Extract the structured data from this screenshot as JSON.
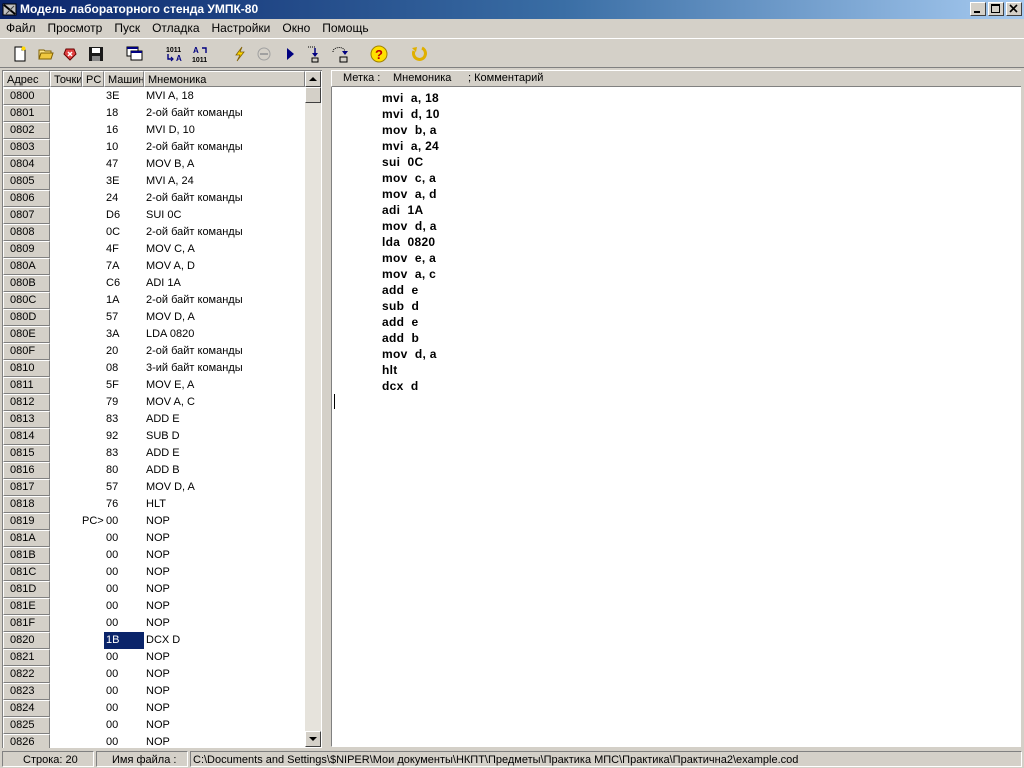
{
  "window": {
    "title": "Модель лабораторного стенда УМПК-80"
  },
  "menu": [
    "Файл",
    "Просмотр",
    "Пуск",
    "Отладка",
    "Настройки",
    "Окно",
    "Помощь"
  ],
  "toolbar": {
    "icons": [
      "new-file-icon",
      "open-folder-icon",
      "erase-icon",
      "save-icon",
      "windows-icon",
      "binary-to-asm-icon",
      "asm-to-binary-icon",
      "run-lightning-icon",
      "stop-icon",
      "step-icon",
      "step-into-icon",
      "step-over-icon",
      "help-icon",
      "restart-icon"
    ],
    "asm_to_bin_top": "1011",
    "asm_to_bin_bottom": "A",
    "bin_to_asm_top": "A",
    "bin_to_asm_bottom": "1011"
  },
  "left_table": {
    "headers": [
      "Адрес",
      "Точки",
      "PC",
      "Машин",
      "Мнемоника"
    ],
    "rows": [
      {
        "addr": "0800",
        "pts": "",
        "pc": "",
        "mc": "3E",
        "mn": "MVI  A, 18"
      },
      {
        "addr": "0801",
        "pts": "",
        "pc": "",
        "mc": "18",
        "mn": "2-ой байт команды"
      },
      {
        "addr": "0802",
        "pts": "",
        "pc": "",
        "mc": "16",
        "mn": "MVI  D, 10"
      },
      {
        "addr": "0803",
        "pts": "",
        "pc": "",
        "mc": "10",
        "mn": "2-ой байт команды"
      },
      {
        "addr": "0804",
        "pts": "",
        "pc": "",
        "mc": "47",
        "mn": "MOV  B, A"
      },
      {
        "addr": "0805",
        "pts": "",
        "pc": "",
        "mc": "3E",
        "mn": "MVI  A, 24"
      },
      {
        "addr": "0806",
        "pts": "",
        "pc": "",
        "mc": "24",
        "mn": "2-ой байт команды"
      },
      {
        "addr": "0807",
        "pts": "",
        "pc": "",
        "mc": "D6",
        "mn": "SUI  0C"
      },
      {
        "addr": "0808",
        "pts": "",
        "pc": "",
        "mc": "0C",
        "mn": "2-ой байт команды"
      },
      {
        "addr": "0809",
        "pts": "",
        "pc": "",
        "mc": "4F",
        "mn": "MOV  C, A"
      },
      {
        "addr": "080A",
        "pts": "",
        "pc": "",
        "mc": "7A",
        "mn": "MOV  A, D"
      },
      {
        "addr": "080B",
        "pts": "",
        "pc": "",
        "mc": "C6",
        "mn": "ADI  1A"
      },
      {
        "addr": "080C",
        "pts": "",
        "pc": "",
        "mc": "1A",
        "mn": "2-ой байт команды"
      },
      {
        "addr": "080D",
        "pts": "",
        "pc": "",
        "mc": "57",
        "mn": "MOV  D, A"
      },
      {
        "addr": "080E",
        "pts": "",
        "pc": "",
        "mc": "3A",
        "mn": "LDA  0820"
      },
      {
        "addr": "080F",
        "pts": "",
        "pc": "",
        "mc": "20",
        "mn": "2-ой байт команды"
      },
      {
        "addr": "0810",
        "pts": "",
        "pc": "",
        "mc": "08",
        "mn": "3-ий байт команды"
      },
      {
        "addr": "0811",
        "pts": "",
        "pc": "",
        "mc": "5F",
        "mn": "MOV  E, A"
      },
      {
        "addr": "0812",
        "pts": "",
        "pc": "",
        "mc": "79",
        "mn": "MOV  A, C"
      },
      {
        "addr": "0813",
        "pts": "",
        "pc": "",
        "mc": "83",
        "mn": "ADD  E"
      },
      {
        "addr": "0814",
        "pts": "",
        "pc": "",
        "mc": "92",
        "mn": "SUB  D"
      },
      {
        "addr": "0815",
        "pts": "",
        "pc": "",
        "mc": "83",
        "mn": "ADD  E"
      },
      {
        "addr": "0816",
        "pts": "",
        "pc": "",
        "mc": "80",
        "mn": "ADD  B"
      },
      {
        "addr": "0817",
        "pts": "",
        "pc": "",
        "mc": "57",
        "mn": "MOV  D, A"
      },
      {
        "addr": "0818",
        "pts": "",
        "pc": "",
        "mc": "76",
        "mn": "HLT"
      },
      {
        "addr": "0819",
        "pts": "",
        "pc": "PC>",
        "mc": "00",
        "mn": "NOP"
      },
      {
        "addr": "081A",
        "pts": "",
        "pc": "",
        "mc": "00",
        "mn": "NOP"
      },
      {
        "addr": "081B",
        "pts": "",
        "pc": "",
        "mc": "00",
        "mn": "NOP"
      },
      {
        "addr": "081C",
        "pts": "",
        "pc": "",
        "mc": "00",
        "mn": "NOP"
      },
      {
        "addr": "081D",
        "pts": "",
        "pc": "",
        "mc": "00",
        "mn": "NOP"
      },
      {
        "addr": "081E",
        "pts": "",
        "pc": "",
        "mc": "00",
        "mn": "NOP"
      },
      {
        "addr": "081F",
        "pts": "",
        "pc": "",
        "mc": "00",
        "mn": "NOP"
      },
      {
        "addr": "0820",
        "pts": "",
        "pc": "",
        "mc": "1B",
        "mn": "DCX  D",
        "selected": true
      },
      {
        "addr": "0821",
        "pts": "",
        "pc": "",
        "mc": "00",
        "mn": "NOP"
      },
      {
        "addr": "0822",
        "pts": "",
        "pc": "",
        "mc": "00",
        "mn": "NOP"
      },
      {
        "addr": "0823",
        "pts": "",
        "pc": "",
        "mc": "00",
        "mn": "NOP"
      },
      {
        "addr": "0824",
        "pts": "",
        "pc": "",
        "mc": "00",
        "mn": "NOP"
      },
      {
        "addr": "0825",
        "pts": "",
        "pc": "",
        "mc": "00",
        "mn": "NOP"
      },
      {
        "addr": "0826",
        "pts": "",
        "pc": "",
        "mc": "00",
        "mn": "NOP"
      }
    ]
  },
  "editor": {
    "header": {
      "label": "Метка :",
      "mnemonic": "Мнемоника",
      "comment": "; Комментарий"
    },
    "lines": [
      "mvi  a, 18",
      "mvi  d, 10",
      "mov  b, a",
      "mvi  a, 24",
      "sui  0C",
      "mov  c, a",
      "mov  a, d",
      "adi  1A",
      "mov  d, a",
      "lda  0820",
      "mov  e, a",
      "mov  a, c",
      "add  e",
      "sub  d",
      "add  e",
      "add  b",
      "mov  d, a",
      "hlt",
      "dcx  d"
    ]
  },
  "status": {
    "line": "Строка: 20",
    "file_label": "Имя файла :",
    "file_path": "C:\\Documents and Settings\\$NIPER\\Мои документы\\НКПТ\\Предметы\\Практика МПС\\Практика\\Практична2\\example.cod"
  },
  "colors": {
    "selection": "#0a246a",
    "title_gradient_start": "#0a246a",
    "title_gradient_end": "#a6caf0",
    "face": "#d4d0c8"
  }
}
